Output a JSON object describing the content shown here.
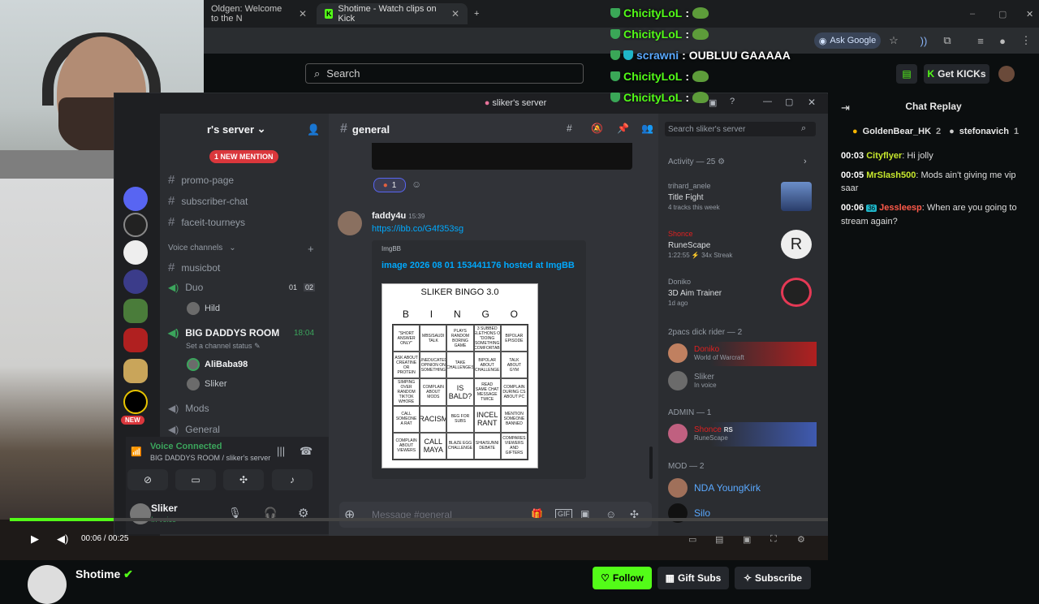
{
  "browser": {
    "tabs": [
      {
        "label": "Oldgen: Welcome to the N"
      },
      {
        "label": "Shotime - Watch clips on Kick"
      }
    ],
    "ask_google": "Ask Google"
  },
  "kick": {
    "search_placeholder": "Search",
    "get_kicks": "Get KICKs",
    "channel_name": "Shotime",
    "follow": "Follow",
    "gift_subs": "Gift Subs",
    "subscribe": "Subscribe",
    "time": "00:06 / 00:25"
  },
  "overlay_chat": [
    {
      "name": "ChicityLoL",
      "msg": ":"
    },
    {
      "name": "ChicityLoL",
      "msg": ":"
    },
    {
      "name": "scrawni",
      "msg": ": OUBLUU GAAAAA"
    },
    {
      "name": "ChicityLoL",
      "msg": ":"
    },
    {
      "name": "ChicityLoL",
      "msg": ":"
    }
  ],
  "discord": {
    "window_title": "sliker's server",
    "server_name": "r's server",
    "new_mention": "1 NEW MENTION",
    "new_badge": "NEW",
    "channels": {
      "promo": "promo-page",
      "subscriber": "subscriber-chat",
      "faceit": "faceit-tourneys",
      "voice_header": "Voice channels",
      "musicbot": "musicbot",
      "duo": "Duo",
      "duo_count_a": "01",
      "duo_count_b": "02",
      "duo_user": "Hild",
      "bigdaddy": "BIG DADDYS ROOM",
      "bigdaddy_time": "18:04",
      "set_status": "Set a channel status",
      "bd_user1": "AliBaba98",
      "bd_user2": "Sliker",
      "mods": "Mods",
      "general": "General"
    },
    "voice_connected": "Voice Connected",
    "voice_location": "BIG DADDYS ROOM / sliker's server",
    "user": {
      "name": "Sliker",
      "status": "In voice"
    },
    "chat": {
      "channel": "general",
      "reaction_count": "1",
      "author": "faddy4u",
      "time": "15:39",
      "link": "https://ibb.co/G4f353sg",
      "embed_provider": "ImgBB",
      "embed_title": "image 2026 08 01 153441176 hosted at ImgBB",
      "bingo_title": "SLIKER BINGO 3.0",
      "bingo_letters": [
        "B",
        "I",
        "N",
        "G",
        "O"
      ],
      "bingo_cells": [
        "\"SHORT ANSWER ONLY\"",
        "MBS/SAUDI TALK",
        "PLAYS RANDOM BORING GAME",
        "3 SUBBED TELETHONS OR \"DOING SOMETHING UNCOMFORTABLE\"",
        "BIPOLAR EPISODE",
        "ASK ABOUT CREATINE OR PROTEIN",
        "UNEDUCATED OPINION ON SOMETHING",
        "TAKE CHALLENGES",
        "BIPOLAR ABOUT CHALLENGE",
        "TALK ABOUT GYM",
        "SIMPING OVER RANDOM TIKTOK WHORE",
        "COMPLAIN ABOUT MODS",
        "IS BALD?",
        "READ SAME CHAT MESSAGE TWICE",
        "COMPLAIN DURING CS ABOUT PC",
        "CALL SOMEONE A RAT",
        "RACISM",
        "BEG FOR SUBS",
        "INCEL RANT",
        "MENTION SOMEONE BANNED",
        "COMPLAIN ABOUT VIEWERS",
        "CALL MAYA",
        "BLAZE EGG CHALLENGE",
        "SHIA/SUNNI DEBATE",
        "COMPARES VIEWERS AND GIFTERS"
      ],
      "message_placeholder": "Message #general"
    },
    "members": {
      "search_placeholder": "Search sliker's server",
      "activity_header": "Activity — 25",
      "activities": [
        {
          "user": "trihard_anele",
          "title": "Title Fight",
          "sub": "4 tracks this week"
        },
        {
          "user": "Shonce",
          "title": "RuneScape",
          "sub": "1:22:55  ⚡ 34x Streak"
        },
        {
          "user": "Doniko",
          "title": "3D Aim Trainer",
          "sub": "1d ago"
        }
      ],
      "group1": "2pacs dick rider — 2",
      "group1_members": [
        {
          "name": "Doniko",
          "sub": "World of Warcraft"
        },
        {
          "name": "Sliker",
          "sub": "In voice"
        }
      ],
      "group2": "ADMIN — 1",
      "group2_members": [
        {
          "name": "Shonce",
          "tag": "RS",
          "sub": "RuneScape"
        }
      ],
      "group3": "MOD — 2",
      "group3_members": [
        {
          "name": "NDA YoungKirk"
        },
        {
          "name": "Silo"
        }
      ]
    }
  },
  "replay": {
    "title": "Chat Replay",
    "gifters": [
      {
        "name": "GoldenBear_HK",
        "count": "2"
      },
      {
        "name": "stefonavich",
        "count": "1"
      }
    ],
    "lines": [
      {
        "time": "00:03",
        "name": "Cityflyer",
        "msg": ": Hi jolly"
      },
      {
        "time": "00:05",
        "name": "MrSlash500",
        "msg": ": Mods ain't giving me vip saar"
      },
      {
        "time": "00:06",
        "name": "Jessleesp",
        "msg": ": When are you going to stream again?"
      }
    ]
  },
  "colors": {
    "kick_green": "#53fc18",
    "discord_bg": "#313338",
    "mention_red": "#da373c"
  }
}
